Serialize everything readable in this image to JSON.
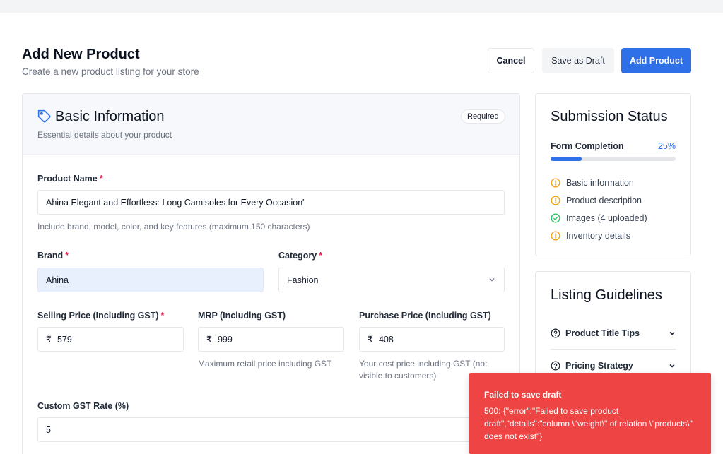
{
  "header": {
    "title": "Add New Product",
    "subtitle": "Create a new product listing for your store"
  },
  "actions": {
    "cancel_label": "Cancel",
    "draft_label": "Save as Draft",
    "add_label": "Add Product",
    "accent_color": "#2f6fe8"
  },
  "basic": {
    "title": "Basic Information",
    "subtitle": "Essential details about your product",
    "badge": "Required",
    "product_name": {
      "label": "Product Name",
      "required_mark": "*",
      "value": "Ahina Elegant and Effortless: Long Camisoles for Every Occasion\"",
      "hint": "Include brand, model, color, and key features (maximum 150 characters)"
    },
    "brand": {
      "label": "Brand",
      "required_mark": "*",
      "value": "Ahina"
    },
    "category": {
      "label": "Category",
      "required_mark": "*",
      "value": "Fashion"
    },
    "selling_price": {
      "label": "Selling Price (Including GST)",
      "required_mark": "*",
      "currency": "₹",
      "value": "579"
    },
    "mrp": {
      "label": "MRP (Including GST)",
      "currency": "₹",
      "value": "999",
      "hint": "Maximum retail price including GST"
    },
    "purchase_price": {
      "label": "Purchase Price (Including GST)",
      "currency": "₹",
      "value": "408",
      "hint": "Your cost price including GST (not visible to customers)"
    },
    "gst": {
      "label": "Custom GST Rate (%)",
      "value": "5"
    }
  },
  "status": {
    "title": "Submission Status",
    "completion_label": "Form Completion",
    "completion_text": "25%",
    "completion_fraction": 0.25,
    "items": [
      {
        "label": "Basic information",
        "state": "pending",
        "icon": "alert-circle-icon"
      },
      {
        "label": "Product description",
        "state": "pending",
        "icon": "alert-circle-icon"
      },
      {
        "label": "Images (4 uploaded)",
        "state": "done",
        "icon": "check-circle-icon"
      },
      {
        "label": "Inventory details",
        "state": "pending",
        "icon": "alert-circle-icon"
      }
    ],
    "pending_color": "#f59e0b",
    "done_color": "#22c55e"
  },
  "guidelines": {
    "title": "Listing Guidelines",
    "items": [
      {
        "label": "Product Title Tips"
      },
      {
        "label": "Pricing Strategy"
      }
    ]
  },
  "toast": {
    "title": "Failed to save draft",
    "message": "500: {\"error\":\"Failed to save product draft\",\"details\":\"column \\\"weight\\\" of relation \\\"products\\\" does not exist\"}",
    "color": "#ef4444"
  }
}
